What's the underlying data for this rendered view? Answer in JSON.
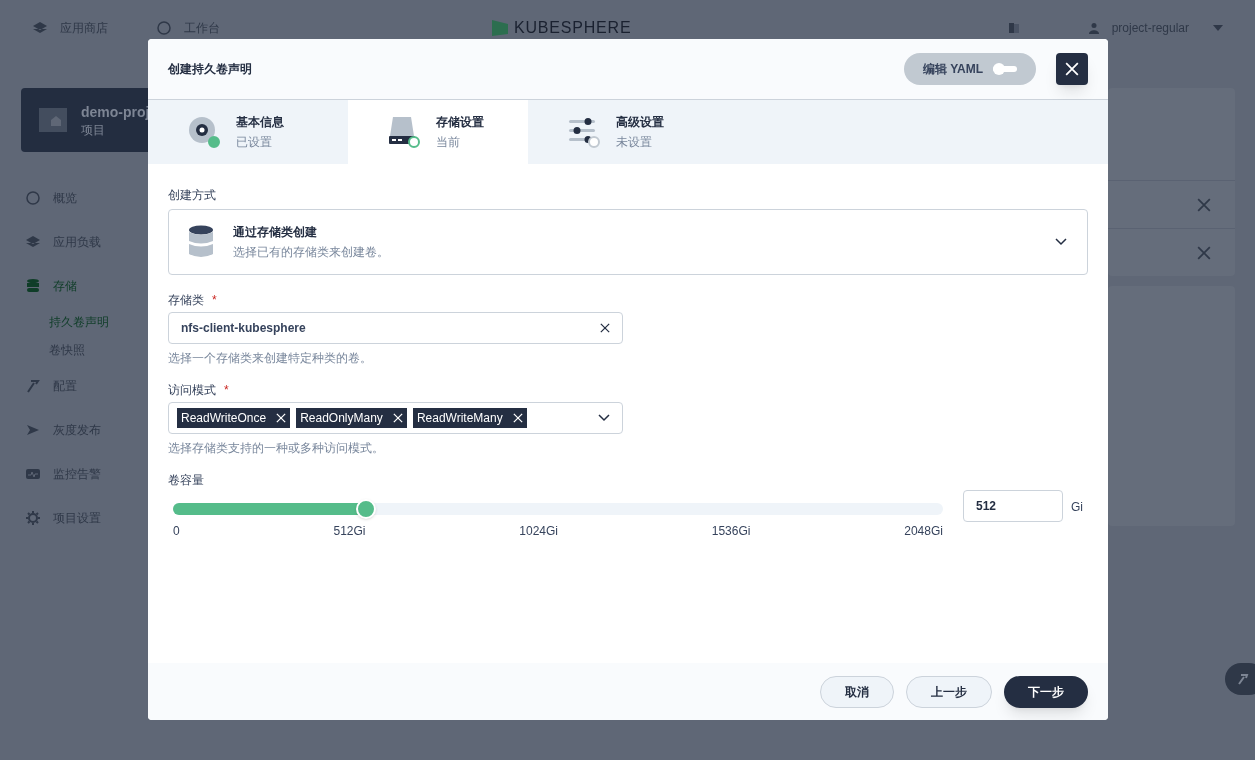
{
  "topbar": {
    "nav": [
      {
        "label": "应用商店"
      },
      {
        "label": "工作台"
      }
    ],
    "logo": "KUBESPHERE",
    "user": "project-regular"
  },
  "sidebar": {
    "project": {
      "name": "demo-proj",
      "type": "项目"
    },
    "items": [
      {
        "label": "概览",
        "selected": false
      },
      {
        "label": "应用负载",
        "selected": false
      },
      {
        "label": "存储",
        "selected": true,
        "children": [
          {
            "label": "持久卷声明",
            "selected": true
          },
          {
            "label": "卷快照",
            "selected": false
          }
        ]
      },
      {
        "label": "配置",
        "selected": false
      },
      {
        "label": "灰度发布",
        "selected": false
      },
      {
        "label": "监控告警",
        "selected": false
      },
      {
        "label": "项目设置",
        "selected": false
      }
    ]
  },
  "dialog": {
    "title": "创建持久卷声明",
    "yaml_toggle": {
      "label": "编辑 YAML",
      "on": false
    },
    "steps": [
      {
        "title": "基本信息",
        "status": "已设置",
        "kind": "done",
        "selected": false
      },
      {
        "title": "存储设置",
        "status": "当前",
        "kind": "current",
        "selected": true
      },
      {
        "title": "高级设置",
        "status": "未设置",
        "kind": "pending",
        "selected": false
      }
    ],
    "method": {
      "label": "创建方式",
      "title": "通过存储类创建",
      "description": "选择已有的存储类来创建卷。"
    },
    "storage_class": {
      "label": "存储类",
      "required_mark": "*",
      "value": "nfs-client-kubesphere",
      "hint": "选择一个存储类来创建特定种类的卷。"
    },
    "access_mode": {
      "label": "访问模式",
      "required_mark": "*",
      "tags": [
        "ReadWriteOnce",
        "ReadOnlyMany",
        "ReadWriteMany"
      ],
      "hint": "选择存储类支持的一种或多种访问模式。"
    },
    "capacity": {
      "label": "卷容量",
      "level": 0.25,
      "ticks": [
        "0",
        "512Gi",
        "1024Gi",
        "1536Gi",
        "2048Gi"
      ],
      "value": "512",
      "unit": "Gi"
    },
    "buttons": [
      {
        "label": "取消",
        "kind": "secondary"
      },
      {
        "label": "上一步",
        "kind": "secondary"
      },
      {
        "label": "下一步",
        "kind": "primary"
      }
    ]
  }
}
